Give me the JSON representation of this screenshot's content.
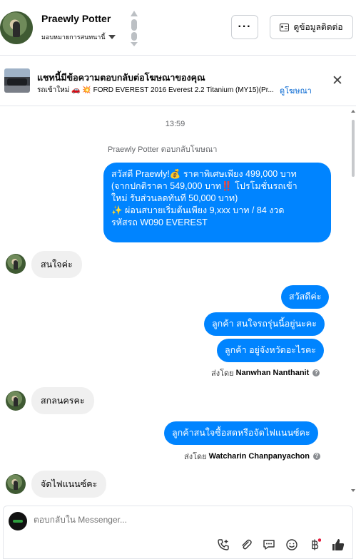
{
  "header": {
    "contact_name": "Praewly Potter",
    "assign_label": "มอบหมายการสนทนานี้",
    "more_label": "···",
    "contact_details_label": "ดูข้อมูลติดต่อ"
  },
  "ad_banner": {
    "title": "แชทนี้มีข้อความตอบกลับต่อโฆษณาของคุณ",
    "subtitle": "รถเข้าใหม่ 🚗 💥 FORD EVEREST 2016 Everest 2.2 Titanium (MY15)(Pr...",
    "view_ad_label": "ดูโฆษณา",
    "close_label": "✕"
  },
  "conversation": {
    "timestamp": "13:59",
    "ad_reply_label": "Praewly Potter ตอบกลับโฆษณา",
    "ad_message_lines": [
      "สวัสดี Praewly!💰 ราคาพิเศษเพียง 499,000 บาท",
      "(จากปกติราคา 549,000 บาท‼️ โปรโมชั่นรถเข้า",
      "ใหม่ รับส่วนลดทันที 50,000 บาท)",
      "✨ ผ่อนสบายเริ่มต้นเพียง 9,xxx บาท / 84 งวด",
      "รหัสรถ W090 EVEREST"
    ],
    "in_1": "สนใจค่ะ",
    "out_1": "สวัสดีค่ะ",
    "out_2": "ลูกค้า สนใจรถรุ่นนี้อยู่นะคะ",
    "out_3": "ลูกค้า อยู่จังหวัดอะไรคะ",
    "sent_by_prefix_1": "ส่งโดย",
    "sent_by_name_1": "Nanwhan Nanthanit",
    "in_2": "สกลนครคะ",
    "out_4": "ลูกค้าสนใจซื้อสดหรือจัดไฟแนนซ์คะ",
    "sent_by_prefix_2": "ส่งโดย",
    "sent_by_name_2": "Watcharin Chanpanyachon",
    "in_3": "จัดไฟแนนซ์คะ"
  },
  "composer": {
    "placeholder": "ตอบกลับใน Messenger..."
  },
  "colors": {
    "accent": "#0084ff",
    "incoming_bubble": "#f0f0f0",
    "link": "#0064d1"
  },
  "icons": [
    "call-add-icon",
    "attachment-icon",
    "saved-replies-icon",
    "emoji-icon",
    "payment-baht-icon",
    "like-icon"
  ]
}
